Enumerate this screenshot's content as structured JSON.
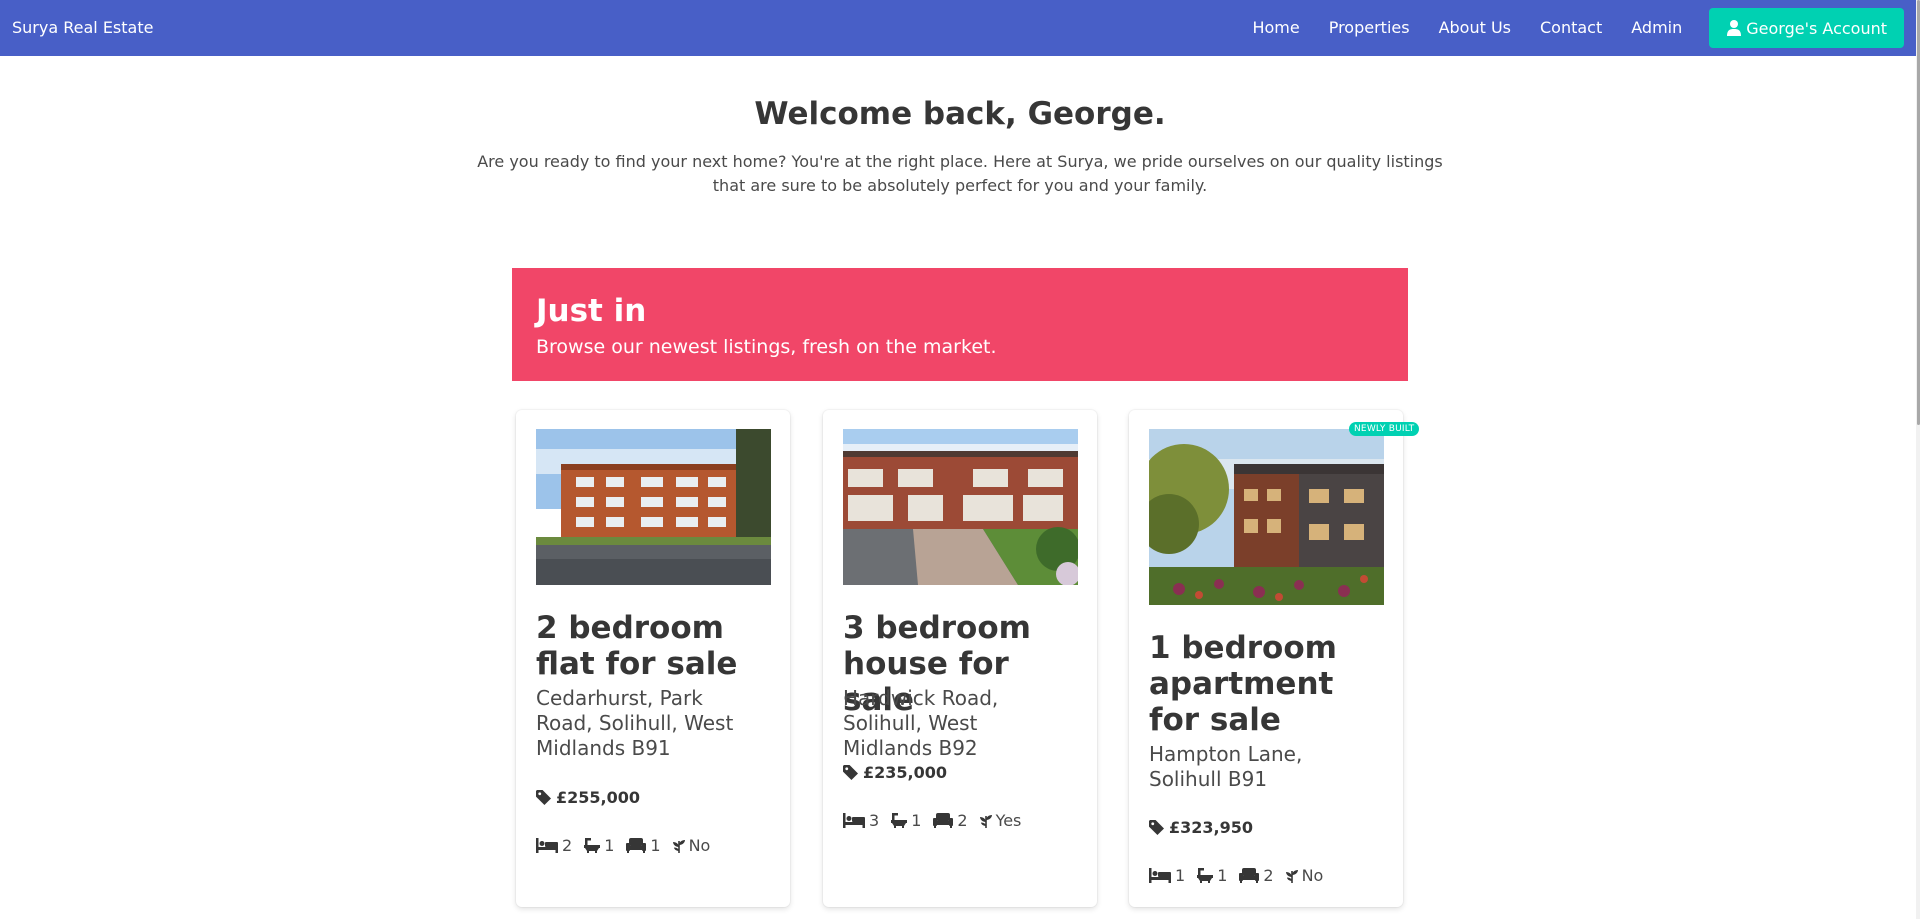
{
  "nav": {
    "brand": "Surya Real Estate",
    "links": [
      "Home",
      "Properties",
      "About Us",
      "Contact",
      "Admin"
    ],
    "account_label": "George's Account"
  },
  "hero": {
    "title": "Welcome back, George.",
    "subtitle": "Are you ready to find your next home? You're at the right place. Here at Surya, we pride ourselves on our quality listings that are sure to be absolutely perfect for you and your family."
  },
  "banner": {
    "title": "Just in",
    "subtitle": "Browse our newest listings, fresh on the market."
  },
  "listings": [
    {
      "title": "2 bedroom flat for sale",
      "address": "Cedarhurst, Park Road, Solihull, West Midlands B91",
      "price": "£255,000",
      "bedrooms": "2",
      "bathrooms": "1",
      "receptions": "1",
      "garden": "No",
      "badge": ""
    },
    {
      "title": "3 bedroom house for sale",
      "address": "Hardwick Road, Solihull, West Midlands B92",
      "price": "£235,000",
      "bedrooms": "3",
      "bathrooms": "1",
      "receptions": "2",
      "garden": "Yes",
      "badge": ""
    },
    {
      "title": "1 bedroom apartment for sale",
      "address": "Hampton Lane, Solihull B91",
      "price": "£323,950",
      "bedrooms": "1",
      "bathrooms": "1",
      "receptions": "2",
      "garden": "No",
      "badge": "NEWLY BUILT"
    }
  ],
  "colors": {
    "navbar": "#485fc7",
    "account_button": "#00d1b2",
    "banner": "#f14668"
  },
  "icons": {
    "account": "user-icon",
    "price": "tag-icon",
    "bedrooms": "bed-icon",
    "bathrooms": "bath-icon",
    "receptions": "couch-icon",
    "garden": "plant-icon"
  }
}
